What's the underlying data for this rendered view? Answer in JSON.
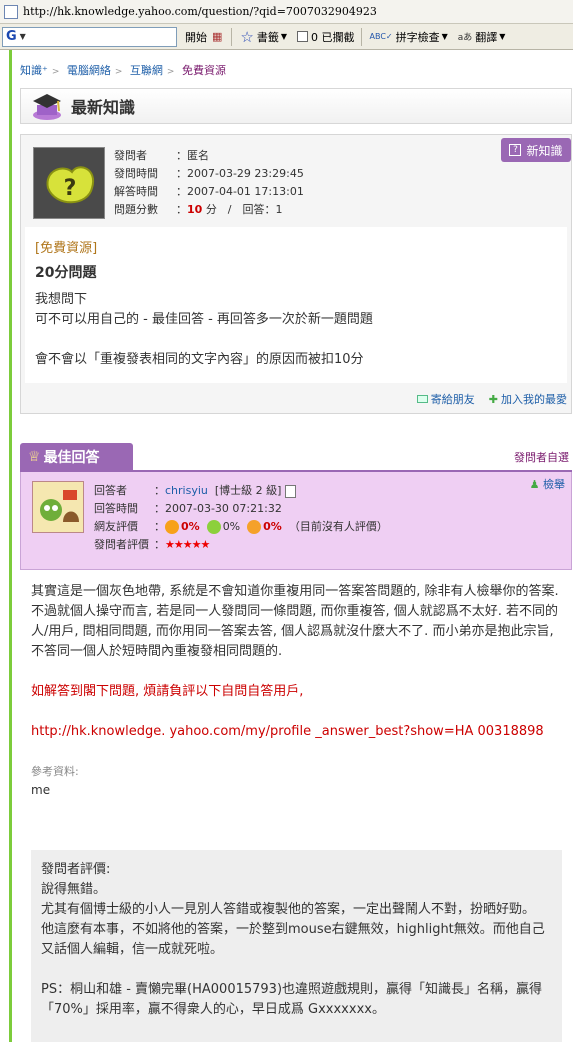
{
  "browser": {
    "url": "http://hk.knowledge.yahoo.com/question/?qid=7007032904923"
  },
  "toolbar": {
    "search_placeholder": "",
    "start": "開始",
    "bookmarks": "書籤",
    "blocked": "0 已攔截",
    "spellcheck": "拼字檢查",
    "translate": "翻譯"
  },
  "breadcrumb": [
    "知識⁺",
    "電腦網絡",
    "互聯網",
    "免費資源"
  ],
  "header": {
    "title": "最新知識"
  },
  "question": {
    "new_button": "新知識",
    "asker_k": "發問者",
    "asker_v": "：匿名",
    "asked_k": "發問時間",
    "asked_v": "：2007-03-29 23:29:45",
    "solved_k": "解答時間",
    "solved_v": "：2007-04-01 17:13:01",
    "score_k": "問題分數",
    "score_prefix": "：",
    "score": "10",
    "score_suffix": "分　/　回答：1",
    "category": "[免費資源]",
    "title": "20分問題",
    "body1": "我想問下",
    "body2": "可不可以用自己的 - 最佳回答 - 再回答多一次於新一題問題",
    "body3": "會不會以「重複發表相同的文字內容」的原因而被扣10分",
    "send_friend": "寄給朋友",
    "add_fav": "加入我的最愛"
  },
  "best": {
    "tab": "最佳回答",
    "asker_choice": "發問者自選",
    "report": "檢舉",
    "answerer_k": "回答者",
    "answerer_name": "chrisyiu",
    "answerer_level": "[博士級 2 級]",
    "time_k": "回答時間",
    "time_v": "：2007-03-30 07:21:32",
    "rating_k": "網友評價",
    "r_good": "0%",
    "r_mid": "0%",
    "r_bad": "0%",
    "r_note": "（目前沒有人評價）",
    "asker_rating_k": "發問者評價",
    "stars": "★★★★★",
    "p1": "其實這是一個灰色地帶, 系統是不會知道你重複用同一答案答問題的, 除非有人檢舉你的答案. 不過就個人操守而言, 若是同一人發問同一條問題, 而你重複答, 個人就認爲不太好. 若不同的人/用戶, 問相同問題, 而你用同一答案去答, 個人認爲就沒什麼大不了. 而小弟亦是抱此宗旨, 不答同一個人於短時間內重複發相同問題的.",
    "p2": "如解答到閣下問題, 煩請負評以下自問自答用戶,",
    "p3": "http://hk.knowledge. yahoo.com/my/profile _answer_best?show=HA 00318898",
    "ref_label": "參考資料:",
    "ref_value": "me"
  },
  "asker_rating": {
    "l1": "發問者評價:",
    "l2": "說得無錯。",
    "l3": "尤其有個博士級的小人一見別人答錯或複製他的答案，一定出聲鬧人不對，扮晒好勁。",
    "l4": "他這麼有本事，不如將他的答案，一於整到mouse右鍵無效，highlight無效。而他自己又話個人編輯，信一成就死啦。",
    "l5": "PS：桐山和雄 - 賣懶完畢(HA00015793)也違照遊戲規則，贏得「知識長」名稱，贏得「70%」採用率，贏不得衆人的心，早日成爲 Gxxxxxxx。"
  },
  "colors": {
    "purple": "#9a68b4",
    "answer_bg": "#efcff3",
    "green_bar": "#7ccc3b",
    "link": "#1d5ea8",
    "red": "#cc0000"
  }
}
